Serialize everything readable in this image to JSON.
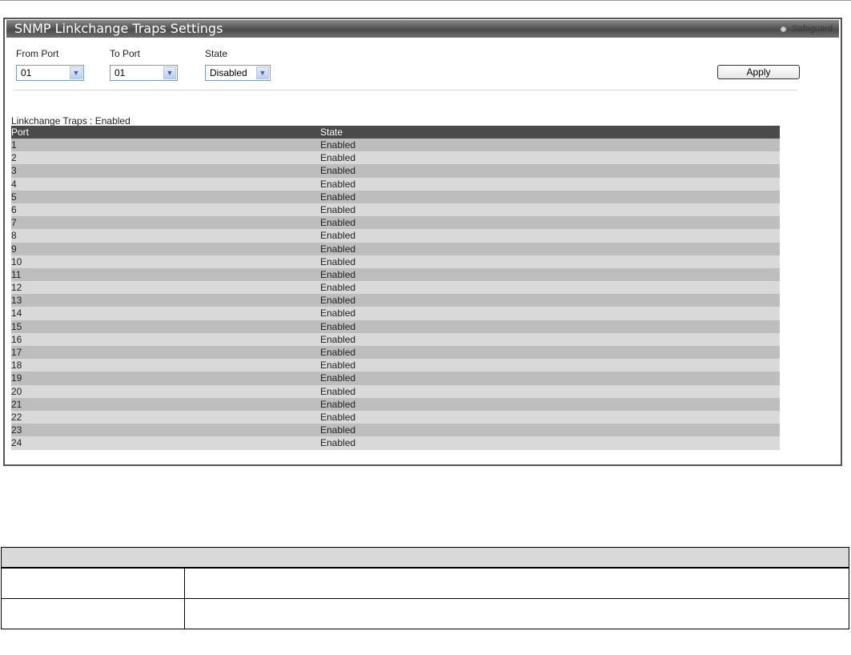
{
  "panel": {
    "title": "SNMP Linkchange Traps Settings",
    "safeguard_label": "Safeguard"
  },
  "form": {
    "from_port": {
      "label": "From Port",
      "value": "01"
    },
    "to_port": {
      "label": "To Port",
      "value": "01"
    },
    "state": {
      "label": "State",
      "value": "Disabled"
    },
    "apply_label": "Apply"
  },
  "summary": "Linkchange Traps : Enabled",
  "table": {
    "columns": [
      "Port",
      "State"
    ],
    "rows": [
      [
        "1",
        "Enabled"
      ],
      [
        "2",
        "Enabled"
      ],
      [
        "3",
        "Enabled"
      ],
      [
        "4",
        "Enabled"
      ],
      [
        "5",
        "Enabled"
      ],
      [
        "6",
        "Enabled"
      ],
      [
        "7",
        "Enabled"
      ],
      [
        "8",
        "Enabled"
      ],
      [
        "9",
        "Enabled"
      ],
      [
        "10",
        "Enabled"
      ],
      [
        "11",
        "Enabled"
      ],
      [
        "12",
        "Enabled"
      ],
      [
        "13",
        "Enabled"
      ],
      [
        "14",
        "Enabled"
      ],
      [
        "15",
        "Enabled"
      ],
      [
        "16",
        "Enabled"
      ],
      [
        "17",
        "Enabled"
      ],
      [
        "18",
        "Enabled"
      ],
      [
        "19",
        "Enabled"
      ],
      [
        "20",
        "Enabled"
      ],
      [
        "21",
        "Enabled"
      ],
      [
        "22",
        "Enabled"
      ],
      [
        "23",
        "Enabled"
      ],
      [
        "24",
        "Enabled"
      ]
    ]
  },
  "icons": {
    "dropdown": "chevron-down-icon",
    "safeguard": "radio-indicator-icon"
  },
  "colors": {
    "header_bg": "#4a4a4a",
    "row_odd": "#bdbdbd",
    "row_even": "#d9d9d9"
  }
}
